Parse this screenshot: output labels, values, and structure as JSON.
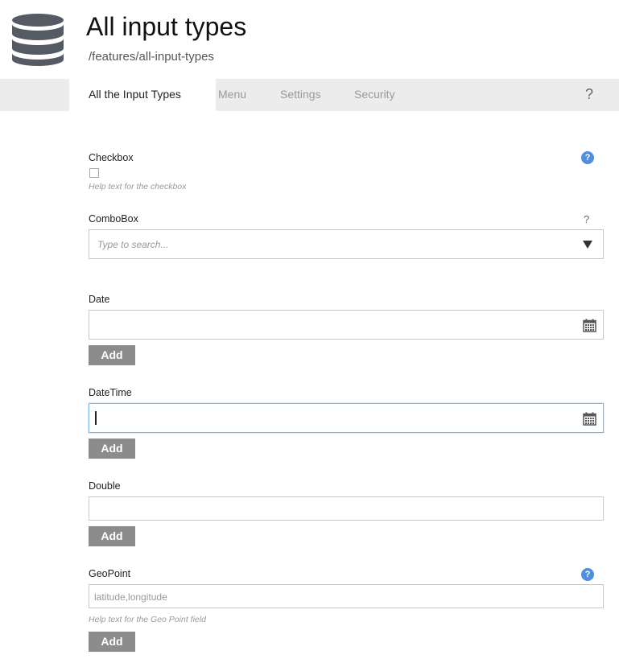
{
  "header": {
    "title": "All input types",
    "path": "/features/all-input-types",
    "icon": "database-icon"
  },
  "tabs": [
    {
      "label": "All the Input Types",
      "active": true
    },
    {
      "label": "Menu",
      "active": false
    },
    {
      "label": "Settings",
      "active": false
    },
    {
      "label": "Security",
      "active": false
    }
  ],
  "tabbar_help": "?",
  "fields": {
    "checkbox": {
      "label": "Checkbox",
      "help_text": "Help text for the checkbox",
      "help_badge": "?",
      "checked": false
    },
    "combobox": {
      "label": "ComboBox",
      "placeholder": "Type to search...",
      "help": "?"
    },
    "date": {
      "label": "Date",
      "value": "",
      "add_label": "Add"
    },
    "datetime": {
      "label": "DateTime",
      "value": "",
      "add_label": "Add"
    },
    "double": {
      "label": "Double",
      "value": "",
      "add_label": "Add"
    },
    "geopoint": {
      "label": "GeoPoint",
      "placeholder": "latitude,longitude",
      "help_text": "Help text for the Geo Point field",
      "help_badge": "?",
      "add_label": "Add"
    }
  },
  "colors": {
    "help_badge": "#4f8ee0",
    "add_button": "#8c8c8c",
    "tabbar": "#ececec",
    "focus_border": "#7fb3e6"
  }
}
